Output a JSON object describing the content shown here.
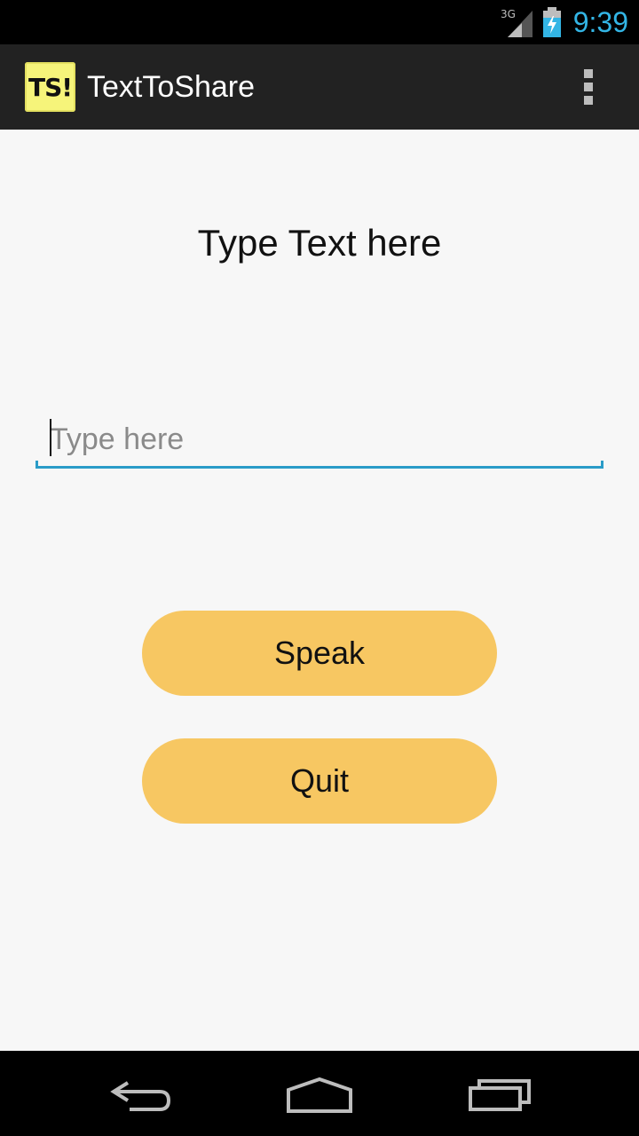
{
  "status_bar": {
    "network_label": "3G",
    "clock": "9:39",
    "accent_color": "#33b5e5"
  },
  "action_bar": {
    "app_icon_text": "TS!",
    "title": "TextToShare",
    "menu_icon": "overflow-menu-icon"
  },
  "main": {
    "heading": "Type Text here",
    "input": {
      "placeholder": "Type here",
      "value": ""
    },
    "buttons": {
      "speak_label": "Speak",
      "quit_label": "Quit",
      "color": "#f7c762"
    }
  },
  "nav_bar": {
    "back_icon": "back-icon",
    "home_icon": "home-icon",
    "recents_icon": "recent-apps-icon"
  }
}
